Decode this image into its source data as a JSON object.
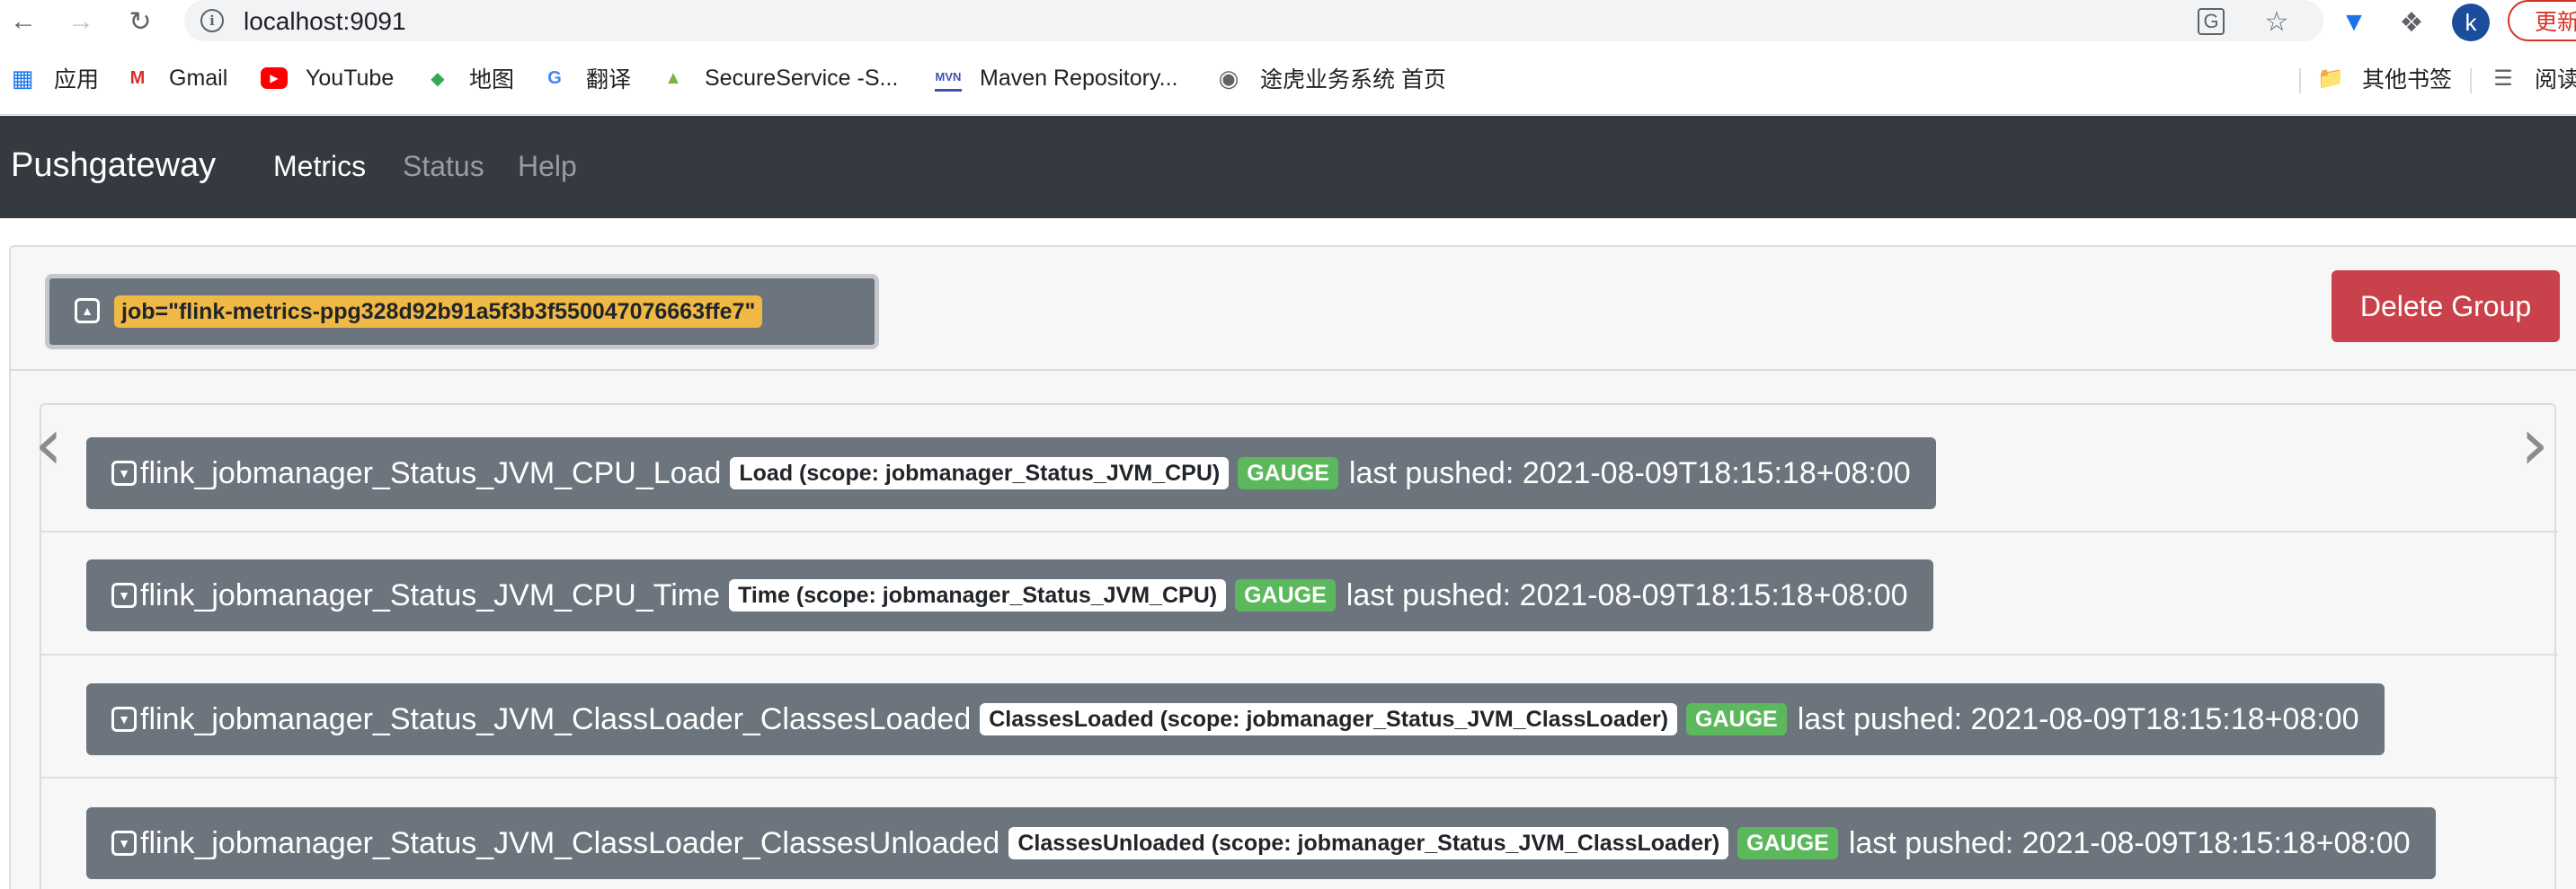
{
  "browser": {
    "url": "localhost:9091",
    "update_label": "更新",
    "avatar_letter": "k",
    "bookmarks": [
      {
        "label": "应用",
        "icon": "apps-grid-icon"
      },
      {
        "label": "Gmail",
        "icon": "gmail-icon"
      },
      {
        "label": "YouTube",
        "icon": "youtube-icon"
      },
      {
        "label": "地图",
        "icon": "maps-icon"
      },
      {
        "label": "翻译",
        "icon": "translate-icon"
      },
      {
        "label": "SecureService -S...",
        "icon": "secure-service-icon"
      },
      {
        "label": "Maven Repository...",
        "icon": "maven-icon"
      },
      {
        "label": "途虎业务系统 首页",
        "icon": "globe-icon"
      }
    ],
    "other_bookmarks": "其他书签",
    "reading_list": "阅读"
  },
  "navbar": {
    "brand": "Pushgateway",
    "links": [
      {
        "label": "Metrics",
        "active": true
      },
      {
        "label": "Status",
        "active": false
      },
      {
        "label": "Help",
        "active": false
      }
    ]
  },
  "group": {
    "label": "job=\"flink-metrics-ppg328d92b91a5f3b3f550047076663ffe7\"",
    "delete_label": "Delete Group"
  },
  "metrics": [
    {
      "name": "flink_jobmanager_Status_JVM_CPU_Load",
      "help": "Load (scope: jobmanager_Status_JVM_CPU)",
      "type": "GAUGE",
      "pushed": "last pushed: 2021-08-09T18:15:18+08:00"
    },
    {
      "name": "flink_jobmanager_Status_JVM_CPU_Time",
      "help": "Time (scope: jobmanager_Status_JVM_CPU)",
      "type": "GAUGE",
      "pushed": "last pushed: 2021-08-09T18:15:18+08:00"
    },
    {
      "name": "flink_jobmanager_Status_JVM_ClassLoader_ClassesLoaded",
      "help": "ClassesLoaded (scope: jobmanager_Status_JVM_ClassLoader)",
      "type": "GAUGE",
      "pushed": "last pushed: 2021-08-09T18:15:18+08:00"
    },
    {
      "name": "flink_jobmanager_Status_JVM_ClassLoader_ClassesUnloaded",
      "help": "ClassesUnloaded (scope: jobmanager_Status_JVM_ClassLoader)",
      "type": "GAUGE",
      "pushed": "last pushed: 2021-08-09T18:15:18+08:00"
    }
  ],
  "colors": {
    "navbar_bg": "#343a40",
    "group_badge": "#f0b945",
    "delete_button": "#c9424b",
    "metric_bg": "#6c757d",
    "gauge_badge": "#5cb85c"
  }
}
